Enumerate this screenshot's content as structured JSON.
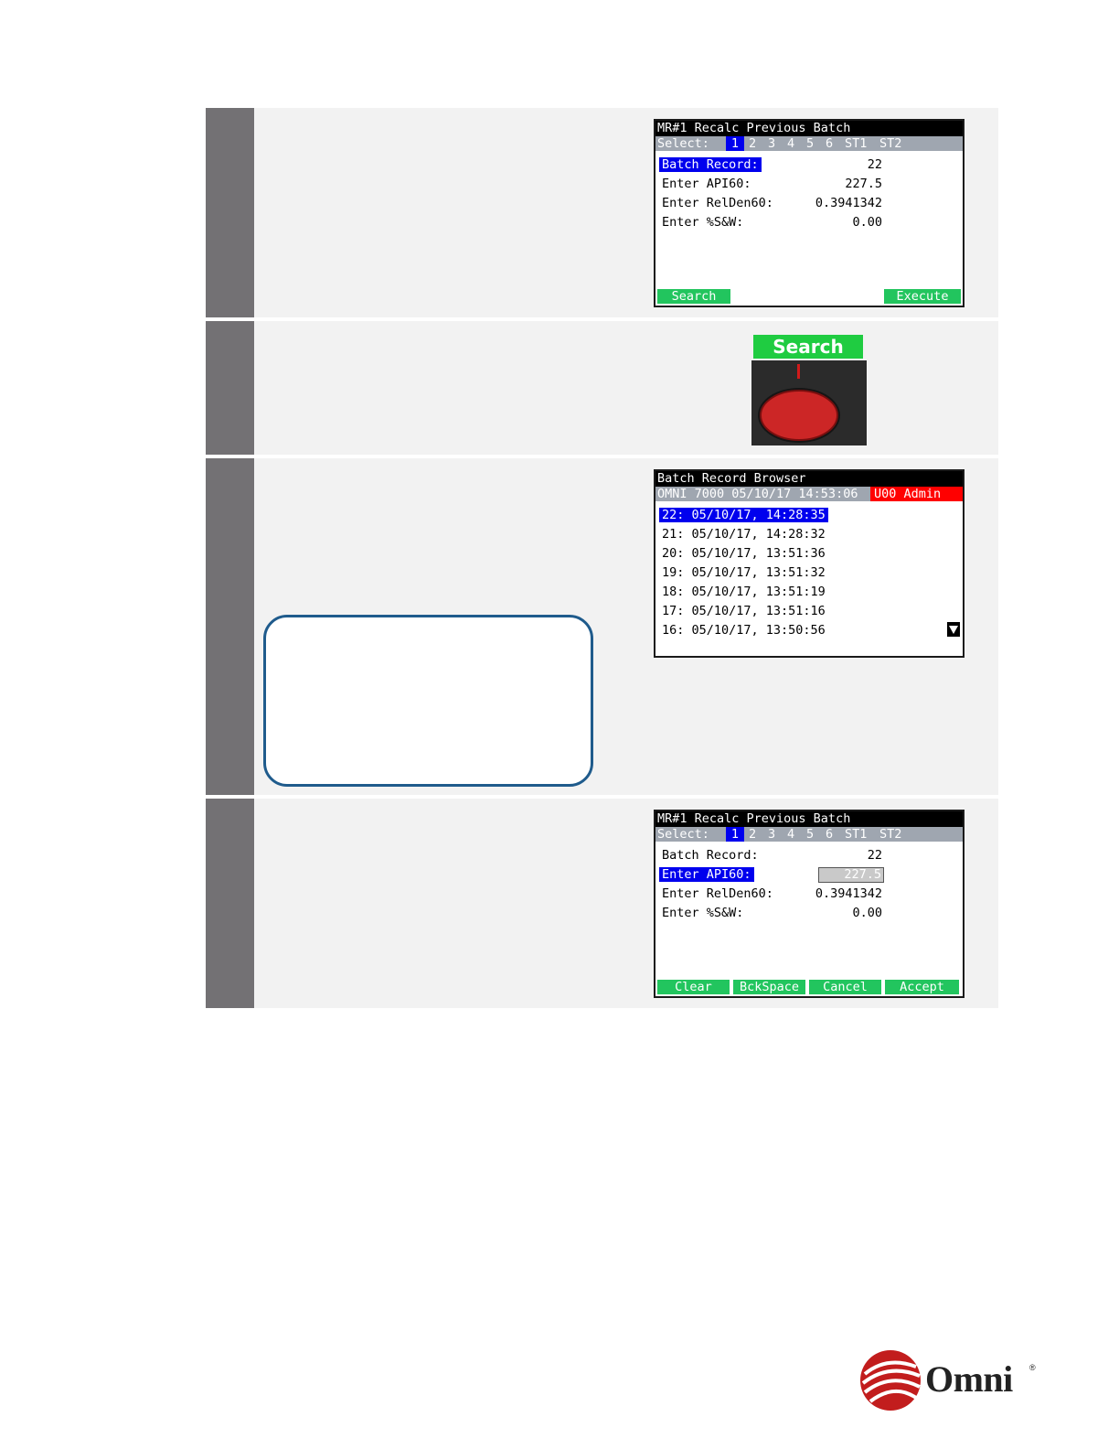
{
  "screen1": {
    "title": "MR#1 Recalc Previous Batch",
    "select_label": "Select:",
    "select_tabs": [
      "1",
      "2",
      "3",
      "4",
      "5",
      "6",
      "ST1",
      "ST2"
    ],
    "fields": [
      {
        "label": "Batch Record:",
        "value": "22"
      },
      {
        "label": "Enter API60:",
        "value": "227.5"
      },
      {
        "label": "Enter RelDen60:",
        "value": "0.3941342"
      },
      {
        "label": "Enter %S&W:",
        "value": "0.00"
      }
    ],
    "softkeys": [
      "Search",
      "Execute"
    ]
  },
  "search_key": {
    "label": "Search",
    "icon": "red-push-button"
  },
  "browser": {
    "title": "Batch Record Browser",
    "status": "OMNI 7000  05/10/17 14:53:06",
    "user": "U00 Admin",
    "records": [
      "22: 05/10/17, 14:28:35",
      "21: 05/10/17, 14:28:32",
      "20: 05/10/17, 13:51:36",
      "19: 05/10/17, 13:51:32",
      "18: 05/10/17, 13:51:19",
      "17: 05/10/17, 13:51:16",
      "16: 05/10/17, 13:50:56"
    ],
    "scroll_icon": "scroll-down-arrow-icon"
  },
  "screen4": {
    "title": "MR#1 Recalc Previous Batch",
    "select_label": "Select:",
    "select_tabs": [
      "1",
      "2",
      "3",
      "4",
      "5",
      "6",
      "ST1",
      "ST2"
    ],
    "fields": [
      {
        "label": "Batch Record:",
        "value": "22"
      },
      {
        "label": "Enter API60:",
        "value": "227.5"
      },
      {
        "label": "Enter RelDen60:",
        "value": "0.3941342"
      },
      {
        "label": "Enter %S&W:",
        "value": "0.00"
      }
    ],
    "softkeys": [
      "Clear",
      "BckSpace",
      "Cancel",
      "Accept"
    ]
  },
  "logo": {
    "text": "Omni",
    "mark": "®"
  },
  "colors": {
    "lcd_highlight": "#0000ee",
    "softkey_green": "#22c55e",
    "user_red": "#ff0000",
    "select_bar": "#9fa6b0",
    "step_bar": "#737174",
    "note_border": "#1f5b8c"
  }
}
